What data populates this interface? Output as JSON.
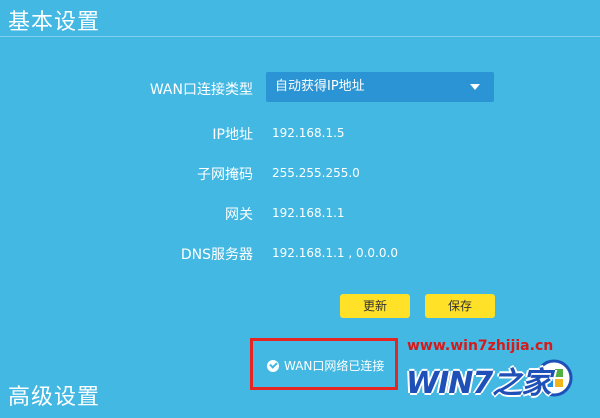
{
  "basic": {
    "title": "基本设置",
    "wan_type": {
      "label": "WAN口连接类型",
      "value": "自动获得IP地址"
    },
    "ip": {
      "label": "IP地址",
      "value": "192.168.1.5"
    },
    "mask": {
      "label": "子网掩码",
      "value": "255.255.255.0"
    },
    "gateway": {
      "label": "网关",
      "value": "192.168.1.1"
    },
    "dns": {
      "label": "DNS服务器",
      "value": "192.168.1.1 , 0.0.0.0"
    },
    "buttons": {
      "refresh": "更新",
      "save": "保存"
    },
    "status": "WAN口网络已连接"
  },
  "advanced": {
    "title": "高级设置"
  },
  "watermark": {
    "url": "www.win7zhijia.cn",
    "logo": "WIN7之家"
  },
  "colors": {
    "background": "#43b8e3",
    "select": "#2a94d4",
    "button": "#ffe227",
    "highlight": "#e52521"
  }
}
